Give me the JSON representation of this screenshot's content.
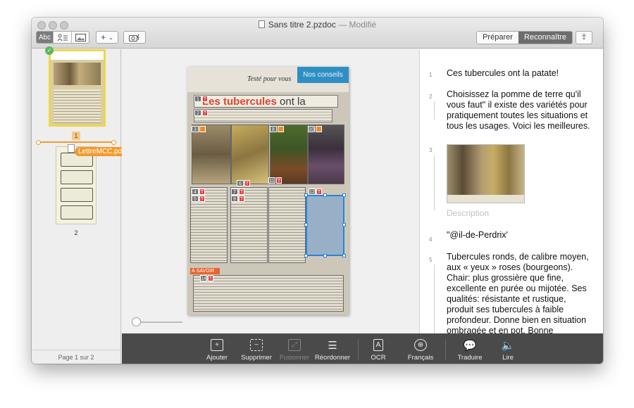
{
  "window": {
    "title": "Sans titre 2.pzdoc",
    "title_suffix": "— Modifié",
    "colors": {
      "accent_orange": "#f29a2c",
      "selection_blue": "#2c82d8",
      "toolbar_dark": "#4a4a4a"
    }
  },
  "toolbar": {
    "text_mode": "Abc",
    "text_mode_icon": "abc-text-icon",
    "picture_mode_icon": "person-lines-icon",
    "image_mode_icon": "image-icon",
    "add_label": "+",
    "add_icon": "chevron-down-icon",
    "camera_icon": "camera-icon",
    "mode_prepare": "Préparer",
    "mode_recognize": "Reconnaître",
    "active_mode": "Reconnaître",
    "share_icon": "share-icon",
    "share_glyph": "⇪"
  },
  "sidebar": {
    "page1_number": "1",
    "page1_check": "✓",
    "page2_number": "2",
    "drag_file": "LettreMCC.pdf",
    "footer": "Page 1 sur 2"
  },
  "document": {
    "header_text": "Testé pour vous",
    "section_tag": "Nos conseils",
    "headline_red": "Les tubercules",
    "headline_black": " ont la patate !",
    "savoir_label": "À SAVOIR",
    "zone_badges": [
      "1",
      "2",
      "3",
      "4",
      "5",
      "6",
      "7",
      "8",
      "9",
      "10",
      "11",
      "12",
      "14"
    ],
    "zone_type_text": "T"
  },
  "transcript": {
    "blocks": [
      {
        "num": "1",
        "text": "Ces tubercules ont la patate!"
      },
      {
        "num": "2",
        "text": "Choisissez la pomme de terre qu'il vous faut\" il existe des variétés pour pratiquement toutes les situations et tous les usages. Voici les meilleures."
      },
      {
        "num": "3",
        "text": ""
      },
      {
        "num": "4",
        "text": "\"@il-de-Perdrix'"
      },
      {
        "num": "5",
        "text": "Tubercules ronds, de calibre moyen, aux « yeux » roses (bourgeons).  Chair: plus grossière que fine, excellente en purée ou mijotée.  Ses qualités: résistante et rustique, produit ses tubercules à faible profondeur. Donne bien en situation ombragée et en pot. Bonne"
      }
    ],
    "image_description_placeholder": "Description"
  },
  "bottom_toolbar": {
    "items": [
      {
        "label": "Ajouter",
        "icon": "add-zone-icon",
        "glyph": "+",
        "enabled": true
      },
      {
        "label": "Supprimer",
        "icon": "delete-zone-icon",
        "glyph": "−",
        "enabled": true
      },
      {
        "label": "Fusionner",
        "icon": "merge-zones-icon",
        "glyph": "⤢",
        "enabled": false
      },
      {
        "label": "Réordonner",
        "icon": "reorder-list-icon",
        "glyph": "☰",
        "enabled": true
      },
      {
        "label": "OCR",
        "icon": "ocr-document-icon",
        "glyph": "A",
        "enabled": true
      },
      {
        "label": "Français",
        "icon": "globe-icon",
        "glyph": "⊕",
        "enabled": true
      },
      {
        "label": "Traduire",
        "icon": "speech-bubbles-icon",
        "glyph": "💬",
        "enabled": true
      },
      {
        "label": "Lire",
        "icon": "speaker-icon",
        "glyph": "🔈",
        "enabled": true
      }
    ]
  }
}
